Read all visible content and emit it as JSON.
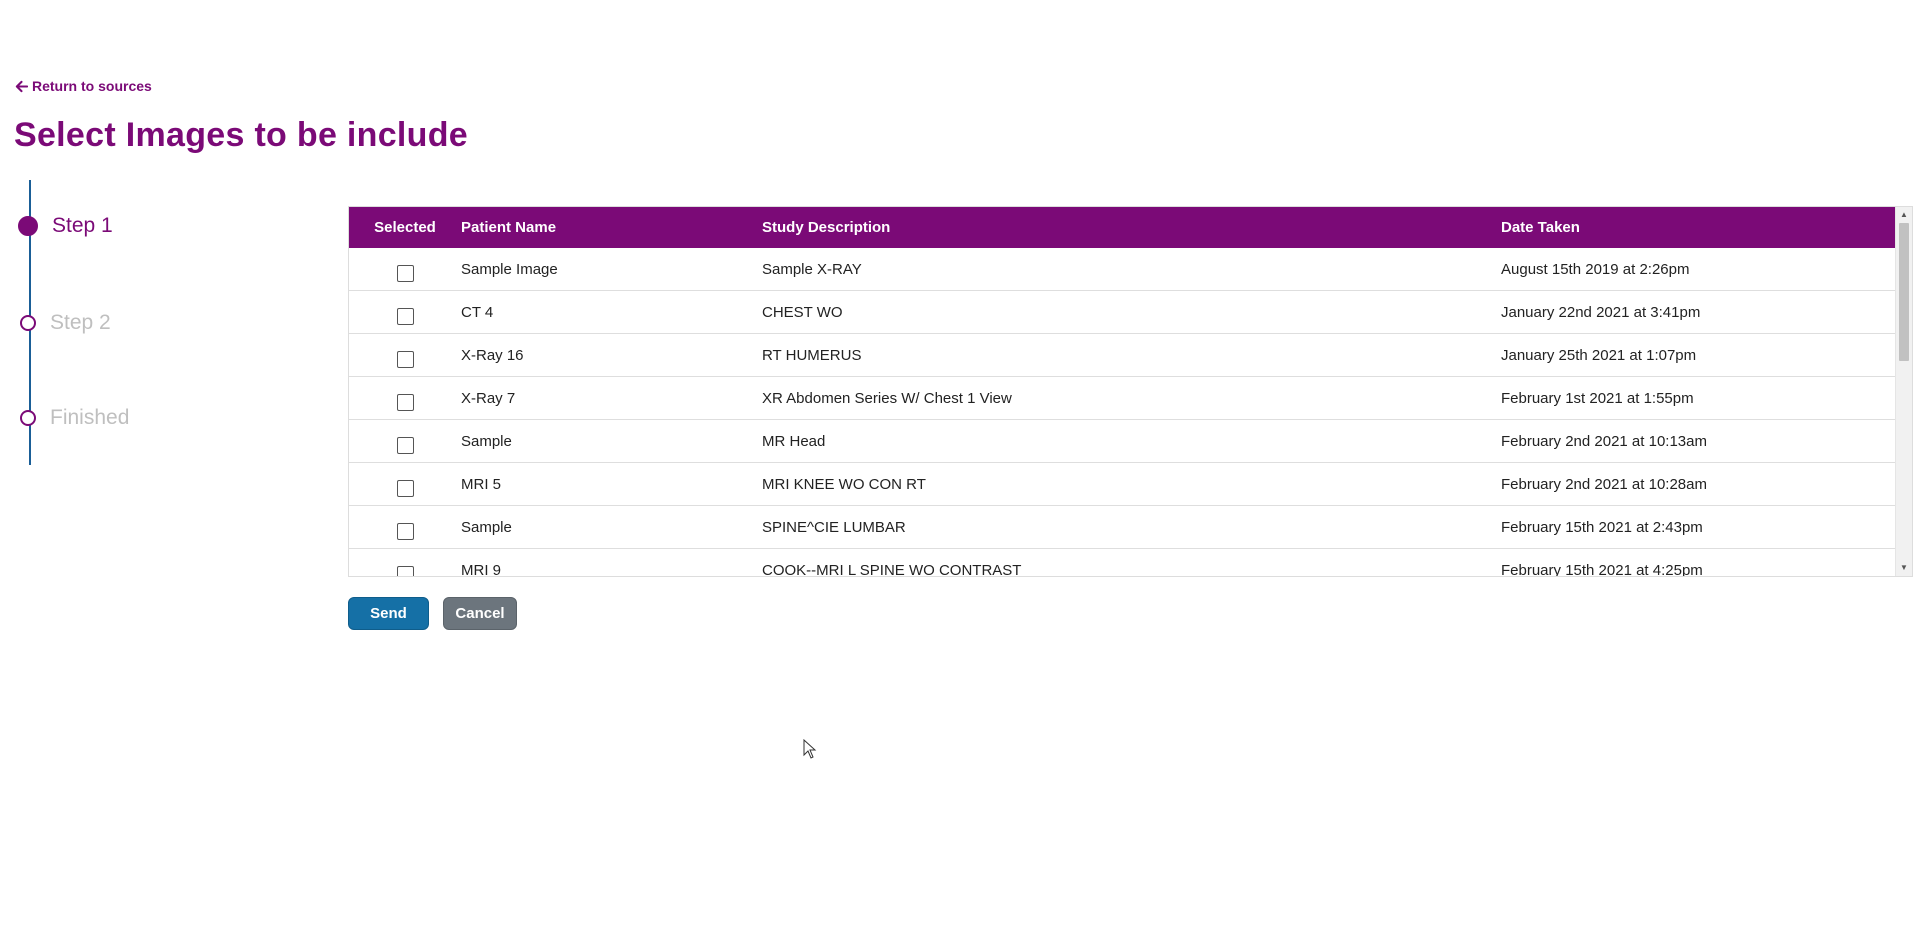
{
  "nav": {
    "back_label": "Return to sources"
  },
  "page": {
    "title": "Select Images to be include"
  },
  "stepper": {
    "steps": [
      {
        "label": "Step 1",
        "state": "active"
      },
      {
        "label": "Step 2",
        "state": "inactive"
      },
      {
        "label": "Finished",
        "state": "inactive"
      }
    ]
  },
  "table": {
    "headers": {
      "selected": "Selected",
      "patient_name": "Patient Name",
      "study_description": "Study Description",
      "date_taken": "Date Taken"
    },
    "rows": [
      {
        "selected": false,
        "patient_name": "Sample Image",
        "study_description": "Sample X-RAY",
        "date_taken": "August 15th 2019 at 2:26pm"
      },
      {
        "selected": false,
        "patient_name": "CT 4",
        "study_description": "CHEST WO",
        "date_taken": "January 22nd 2021 at 3:41pm"
      },
      {
        "selected": false,
        "patient_name": "X-Ray 16",
        "study_description": "RT HUMERUS",
        "date_taken": "January 25th 2021 at 1:07pm"
      },
      {
        "selected": false,
        "patient_name": "X-Ray 7",
        "study_description": "XR Abdomen Series W/ Chest 1 View",
        "date_taken": "February 1st 2021 at 1:55pm"
      },
      {
        "selected": false,
        "patient_name": "Sample",
        "study_description": "MR Head",
        "date_taken": "February 2nd 2021 at 10:13am"
      },
      {
        "selected": false,
        "patient_name": "MRI 5",
        "study_description": "MRI KNEE WO CON RT",
        "date_taken": "February 2nd 2021 at 10:28am"
      },
      {
        "selected": false,
        "patient_name": "Sample",
        "study_description": "SPINE^CIE LUMBAR",
        "date_taken": "February 15th 2021 at 2:43pm"
      },
      {
        "selected": false,
        "patient_name": "MRI 9",
        "study_description": "COOK--MRI L SPINE WO CONTRAST",
        "date_taken": "February 15th 2021 at 4:25pm"
      }
    ]
  },
  "actions": {
    "send_label": "Send",
    "cancel_label": "Cancel"
  },
  "colors": {
    "brand_purple": "#7b0a77",
    "send_blue": "#1570a6",
    "cancel_gray": "#6c757d",
    "stepper_line": "#1a5e97"
  }
}
